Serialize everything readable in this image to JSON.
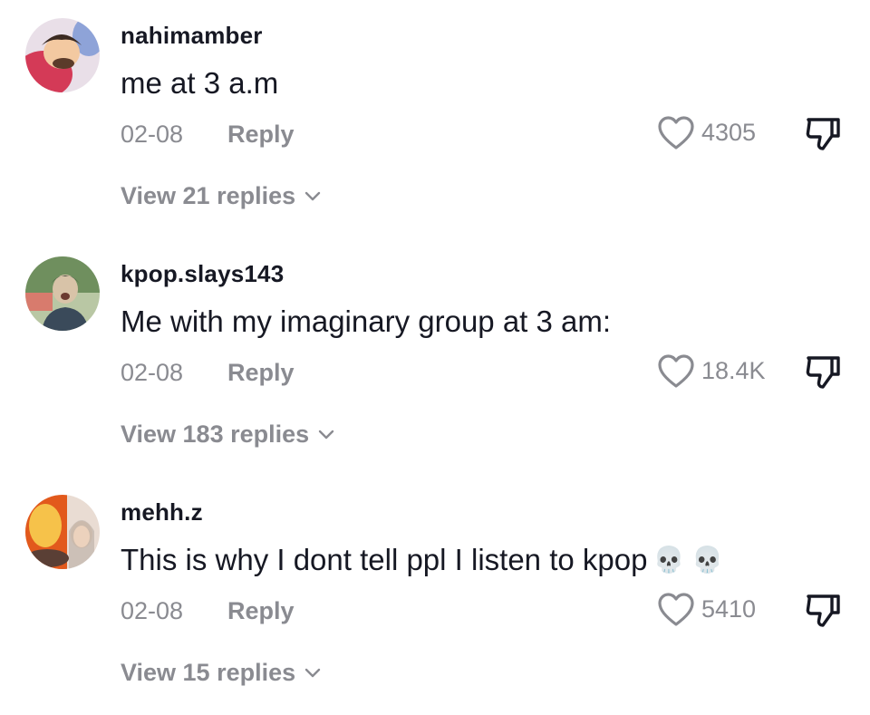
{
  "comments": [
    {
      "username": "nahimamber",
      "text": "me at 3 a.m",
      "date": "02-08",
      "reply_label": "Reply",
      "likes": "4305",
      "view_replies": "View 21 replies",
      "avatar_colors": [
        "#d43a57",
        "#f3c9a1",
        "#3b2a21",
        "#8ea3d8"
      ]
    },
    {
      "username": "kpop.slays143",
      "text": "Me with my imaginary group at 3 am:",
      "date": "02-08",
      "reply_label": "Reply",
      "likes": "18.4K",
      "view_replies": "View 183 replies",
      "avatar_colors": [
        "#6f8f5e",
        "#d8c3a8",
        "#3a4236",
        "#b9c7a4"
      ]
    },
    {
      "username": "mehh.z",
      "text": "This is why I dont tell ppl I listen to kpop",
      "emoji": "💀 💀",
      "date": "02-08",
      "reply_label": "Reply",
      "likes": "5410",
      "view_replies": "View 15 replies",
      "avatar_colors": [
        "#e2591c",
        "#f6c24a",
        "#5a3f35",
        "#e9dcd3"
      ]
    }
  ],
  "icons": {
    "like": "heart-outline-icon",
    "dislike": "thumbs-down-icon",
    "expand": "chevron-down-icon",
    "skull": "skull-emoji"
  },
  "colors": {
    "primary_text": "#161823",
    "secondary_text": "#8a8b91"
  }
}
